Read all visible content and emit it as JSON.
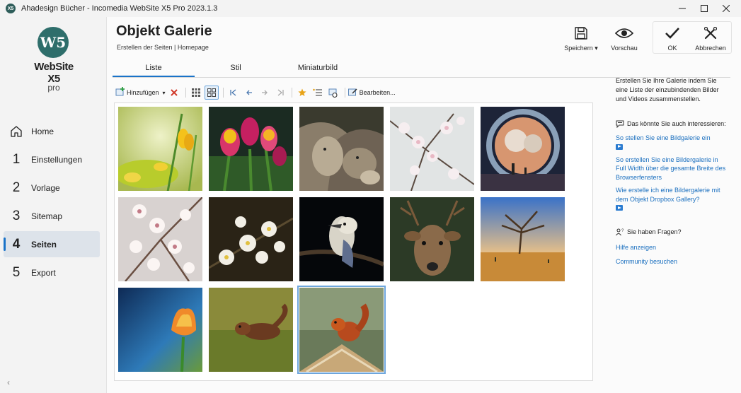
{
  "window": {
    "title": "Ahadesign Bücher - Incomedia WebSite X5 Pro 2023.1.3",
    "app_icon_text": "X5",
    "controls": [
      "minimize-icon",
      "maximize-icon",
      "close-icon"
    ]
  },
  "sidebar": {
    "logo": {
      "mark": "W5",
      "brand": "WebSite X5",
      "edition": "pro"
    },
    "items": [
      {
        "num": "",
        "label": "Home",
        "icon": "home-icon",
        "active": false
      },
      {
        "num": "1",
        "label": "Einstellungen",
        "active": false
      },
      {
        "num": "2",
        "label": "Vorlage",
        "active": false
      },
      {
        "num": "3",
        "label": "Sitemap",
        "active": false
      },
      {
        "num": "4",
        "label": "Seiten",
        "active": true
      },
      {
        "num": "5",
        "label": "Export",
        "active": false
      }
    ],
    "collapse_glyph": "‹"
  },
  "header": {
    "title": "Objekt Galerie",
    "breadcrumb": "Erstellen der Seiten | Homepage",
    "buttons": {
      "save": "Speichern",
      "preview": "Vorschau",
      "ok": "OK",
      "cancel": "Abbrechen"
    },
    "save_dropdown_glyph": "▾"
  },
  "tabs": [
    {
      "label": "Liste",
      "active": true
    },
    {
      "label": "Stil",
      "active": false
    },
    {
      "label": "Miniaturbild",
      "active": false
    }
  ],
  "gallery_toolbar": {
    "add_label": "Hinzufügen",
    "add_dropdown_glyph": "▾",
    "edit_label": "Bearbeiten..."
  },
  "gallery": {
    "thumbnails": [
      {
        "subject": "yellow crocus flowers",
        "selected": false
      },
      {
        "subject": "tulips",
        "selected": false
      },
      {
        "subject": "wolves",
        "selected": false
      },
      {
        "subject": "white blossom branch",
        "selected": false
      },
      {
        "subject": "portal with moons",
        "selected": false
      },
      {
        "subject": "cherry blossoms",
        "selected": false
      },
      {
        "subject": "white blossoms dark",
        "selected": false
      },
      {
        "subject": "kookaburra",
        "selected": false
      },
      {
        "subject": "deer",
        "selected": false
      },
      {
        "subject": "savanna tree",
        "selected": false
      },
      {
        "subject": "orange flower blue background",
        "selected": false
      },
      {
        "subject": "squirrel on grass",
        "selected": false
      },
      {
        "subject": "squirrel on roof",
        "selected": true
      }
    ]
  },
  "help": {
    "intro": "Erstellen Sie Ihre Galerie indem Sie eine Liste der einzubindenden Bilder und Videos zusammenstellen.",
    "interest_header": "Das könnte Sie auch interessieren:",
    "links": [
      "So stellen Sie eine Bildgalerie ein",
      "So erstellen Sie eine Bildergalerie in Full Width über die gesamte Breite des Browserfensters",
      "Wie erstelle ich eine Bildergalerie mit dem Objekt Dropbox Gallery?"
    ],
    "questions_header": "Sie haben Fragen?",
    "support_links": [
      "Hilfe anzeigen",
      "Community besuchen"
    ]
  },
  "colors": {
    "accent": "#1a73c8",
    "link": "#1a6fbf",
    "logo": "#2e6e6b",
    "delete": "#d13a2b",
    "star": "#e8a317"
  }
}
